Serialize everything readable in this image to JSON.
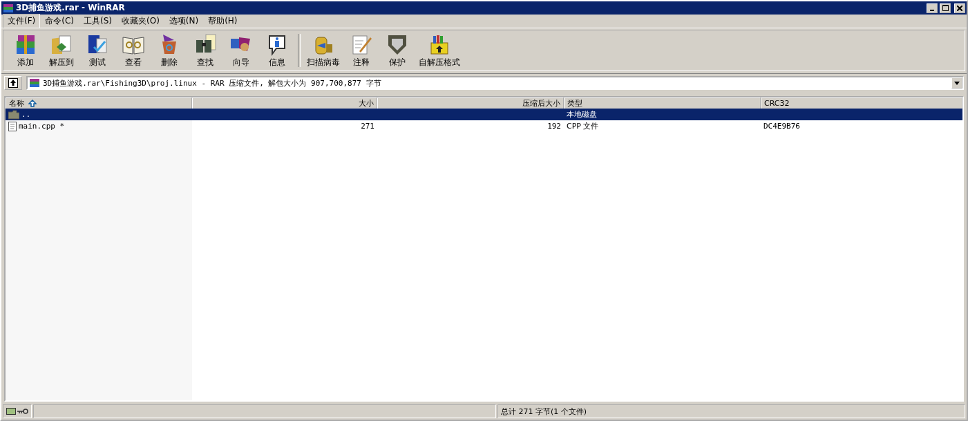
{
  "window": {
    "title": "3D捕鱼游戏.rar - WinRAR"
  },
  "menu": [
    {
      "label": "文件(F)",
      "selected": true
    },
    {
      "label": "命令(C)",
      "selected": false
    },
    {
      "label": "工具(S)",
      "selected": false
    },
    {
      "label": "收藏夹(O)",
      "selected": false
    },
    {
      "label": "选项(N)",
      "selected": false
    },
    {
      "label": "帮助(H)",
      "selected": false
    }
  ],
  "toolbar": {
    "groups": [
      [
        "添加",
        "解压到",
        "测试",
        "查看",
        "删除",
        "查找",
        "向导",
        "信息"
      ],
      [
        "扫描病毒",
        "注释",
        "保护",
        "自解压格式"
      ]
    ]
  },
  "address": {
    "value": "3D捕鱼游戏.rar\\Fishing3D\\proj.linux - RAR 压缩文件, 解包大小为 907,700,877 字节"
  },
  "table": {
    "columns": [
      {
        "label": "名称",
        "sorted": true
      },
      {
        "label": "大小",
        "sorted": false
      },
      {
        "label": "压缩后大小",
        "sorted": false
      },
      {
        "label": "类型",
        "sorted": false
      },
      {
        "label": "CRC32",
        "sorted": false
      }
    ],
    "rows": [
      {
        "kind": "folder",
        "selected": true,
        "cells": [
          "..",
          "",
          "",
          "本地磁盘",
          ""
        ]
      },
      {
        "kind": "file",
        "selected": false,
        "cells": [
          "main.cpp *",
          "271",
          "192",
          "CPP 文件",
          "DC4E9B76"
        ]
      }
    ]
  },
  "status_bar": {
    "text": "总计 271 字节(1 个文件)"
  }
}
